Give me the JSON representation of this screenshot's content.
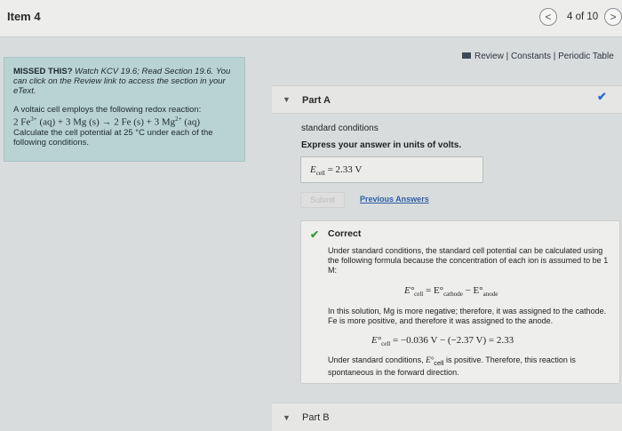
{
  "header": {
    "item_title": "Item 4",
    "counter": "4 of 10",
    "prev_glyph": "<",
    "next_glyph": ">"
  },
  "review_links": "Review | Constants | Periodic Table",
  "hint": {
    "missed": "MISSED THIS?",
    "watch": "Watch KCV 19.6; Read Section 19.6.",
    "review": "You can click on the Review link to access the section in your eText.",
    "problem_intro": "A voltaic cell employs the following redox reaction:",
    "reaction_lhs": "2 Fe",
    "charge_fe": "3+",
    "reaction_mid": " (aq) + 3 Mg (s) → 2 Fe (s) + 3 Mg",
    "charge_mg": "2+",
    "reaction_end": " (aq)",
    "calc": "Calculate the cell potential at 25 °C under each of the following conditions."
  },
  "partA": {
    "title": "Part A",
    "condition": "standard conditions",
    "instruction": "Express your answer in units of volts.",
    "answer_prefix": "E",
    "answer_sub": "cell",
    "answer_value": " = 2.33  V",
    "submit_label": "Submit",
    "previous_answers": "Previous Answers",
    "feedback": {
      "status": "Correct",
      "explanation1": "Under standard conditions, the standard cell potential can be calculated using the following formula because the concentration of each ion is assumed to be 1 M:",
      "formula1_a": "E°",
      "formula1_a_sub": "cell",
      "formula1_b": " = E°",
      "formula1_b_sub": "cathode",
      "formula1_c": " − E°",
      "formula1_c_sub": "anode",
      "explanation2": "In this solution, Mg is more negative; therefore, it was assigned to the cathode. Fe is more positive, and therefore it was assigned to the anode.",
      "formula2_a": "E°",
      "formula2_a_sub": "cell",
      "formula2_b": " = −0.036 V − (−2.37 V) = 2.33",
      "explanation3_a": "Under standard conditions, ",
      "explanation3_e": "E°",
      "explanation3_sub": "cell",
      "explanation3_b": " is positive. Therefore, this reaction is spontaneous in the forward direction."
    }
  },
  "partB": {
    "title": "Part B"
  },
  "colors": {
    "hint_bg": "#b9d3d3",
    "check_blue": "#2a6bd1",
    "correct_green": "#3c9a3c",
    "link_blue": "#2a5fa8"
  }
}
